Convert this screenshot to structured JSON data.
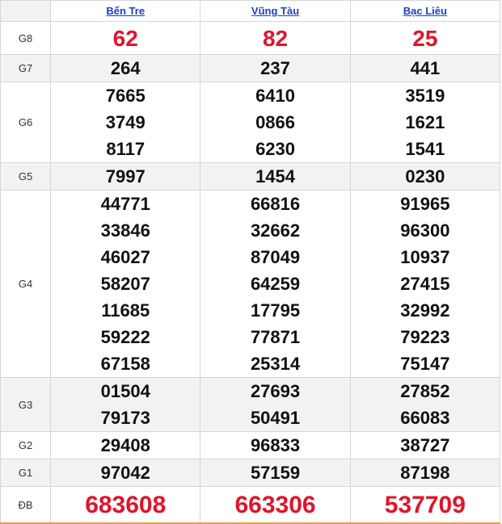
{
  "provinces": [
    "Bến Tre",
    "Vũng Tàu",
    "Bạc Liêu"
  ],
  "prizes": [
    {
      "label": "G8",
      "values": [
        [
          "62"
        ],
        [
          "82"
        ],
        [
          "25"
        ]
      ]
    },
    {
      "label": "G7",
      "values": [
        [
          "264"
        ],
        [
          "237"
        ],
        [
          "441"
        ]
      ]
    },
    {
      "label": "G6",
      "values": [
        [
          "7665",
          "3749",
          "8117"
        ],
        [
          "6410",
          "0866",
          "6230"
        ],
        [
          "3519",
          "1621",
          "1541"
        ]
      ]
    },
    {
      "label": "G5",
      "values": [
        [
          "7997"
        ],
        [
          "1454"
        ],
        [
          "0230"
        ]
      ]
    },
    {
      "label": "G4",
      "values": [
        [
          "44771",
          "33846",
          "46027",
          "58207",
          "11685",
          "59222",
          "67158"
        ],
        [
          "66816",
          "32662",
          "87049",
          "64259",
          "17795",
          "77871",
          "25314"
        ],
        [
          "91965",
          "96300",
          "10937",
          "27415",
          "32992",
          "79223",
          "75147"
        ]
      ]
    },
    {
      "label": "G3",
      "values": [
        [
          "01504",
          "79173"
        ],
        [
          "27693",
          "50491"
        ],
        [
          "27852",
          "66083"
        ]
      ]
    },
    {
      "label": "G2",
      "values": [
        [
          "29408"
        ],
        [
          "96833"
        ],
        [
          "38727"
        ]
      ]
    },
    {
      "label": "G1",
      "values": [
        [
          "97042"
        ],
        [
          "57159"
        ],
        [
          "87198"
        ]
      ]
    },
    {
      "label": "ĐB",
      "values": [
        [
          "683608"
        ],
        [
          "663306"
        ],
        [
          "537709"
        ]
      ]
    }
  ],
  "colors": {
    "highlight": "#e0142b",
    "link": "#1a3fd1",
    "shade": "#f2f2f2"
  }
}
